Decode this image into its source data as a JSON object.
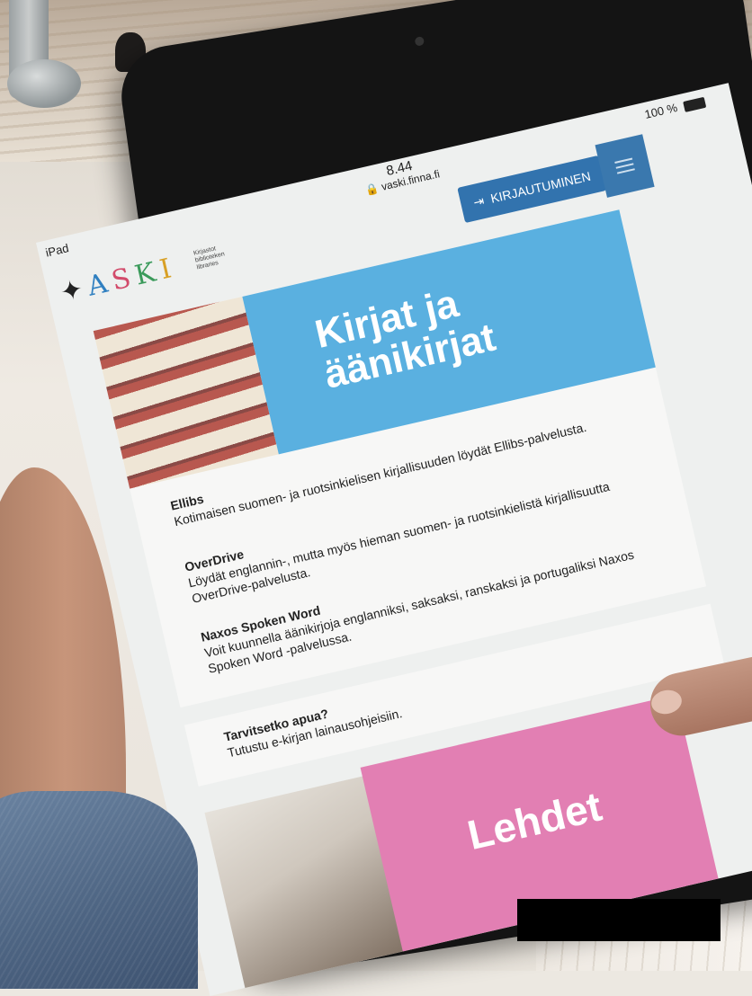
{
  "status_bar": {
    "device": "iPad",
    "time": "8.44",
    "url": "vaski.finna.fi",
    "battery": "100 %"
  },
  "header": {
    "logo_letters": [
      "A",
      "S",
      "K",
      "I"
    ],
    "logo_subtitle": "Kirjastot biblioteken libraries",
    "login_label": "KIRJAUTUMINEN"
  },
  "ebooks": {
    "banner_title": "Kirjat ja äänikirjat",
    "services": [
      {
        "name": "Ellibs",
        "text": "Kotimaisen suomen- ja ruotsinkielisen kirjallisuuden löydät Ellibs-palvelusta."
      },
      {
        "name": "OverDrive",
        "text": "Löydät englannin-, mutta myös hieman suomen- ja ruotsinkielistä kirjallisuutta OverDrive-palvelusta."
      },
      {
        "name": "Naxos Spoken Word",
        "text": "Voit kuunnella äänikirjoja englanniksi, saksaksi, ranskaksi ja portugaliksi Naxos Spoken Word -palvelussa."
      }
    ]
  },
  "help": {
    "title": "Tarvitsetko apua?",
    "text": "Tutustu e-kirjan lainausohjeisiin."
  },
  "magazines": {
    "banner_title": "Lehdet"
  },
  "colors": {
    "accent_blue": "#3273ae",
    "books_banner": "#5ab0e0",
    "magazines_banner": "#e27fb3"
  }
}
